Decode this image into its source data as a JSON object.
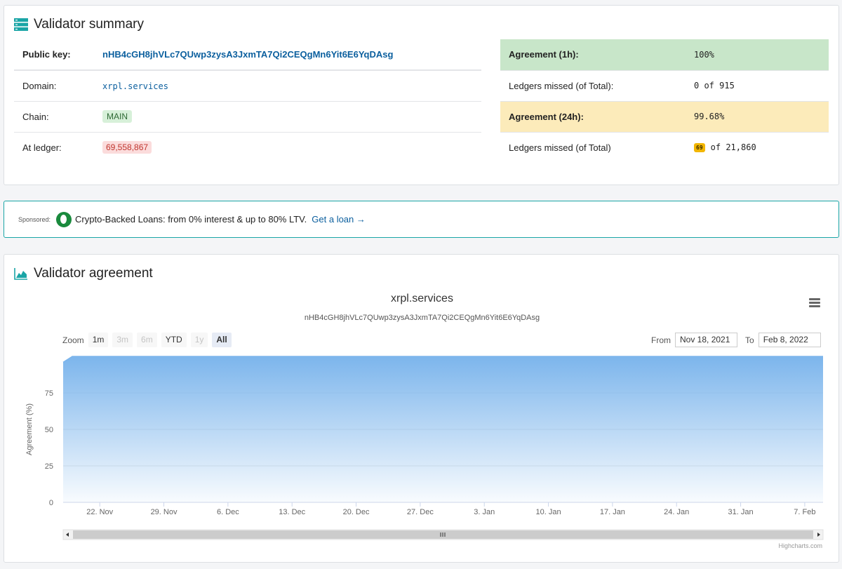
{
  "summary": {
    "title": "Validator summary",
    "left_rows": [
      {
        "key": "Public key:",
        "value": "nHB4cGH8jhVLc7QUwp3zysA3JxmTA7Qi2CEQgMn6Yit6E6YqDAsg"
      },
      {
        "key": "Domain:",
        "value": "xrpl.services"
      },
      {
        "key": "Chain:",
        "value": "MAIN"
      },
      {
        "key": "At ledger:",
        "value": "69,558,867"
      }
    ],
    "right_rows": [
      {
        "key": "Agreement (1h):",
        "value": "100%"
      },
      {
        "key": "Ledgers missed (of Total):",
        "value": "0 of 915"
      },
      {
        "key": "Agreement (24h):",
        "value": "99.68%"
      },
      {
        "key": "Ledgers missed (of Total)",
        "badge": "69",
        "value": "of 21,860"
      }
    ],
    "colors": {
      "agreement_1h_bg": "#c8e6c9",
      "agreement_24h_bg": "#fcebba"
    }
  },
  "sponsor": {
    "label": "Sponsored:",
    "text": "Crypto-Backed Loans: from 0% interest & up to 80% LTV.",
    "link": "Get a loan →"
  },
  "agreement_card": {
    "title": "Validator agreement",
    "zoom_label": "Zoom",
    "zoom_buttons": [
      {
        "label": "1m",
        "state": "enabled"
      },
      {
        "label": "3m",
        "state": "disabled"
      },
      {
        "label": "6m",
        "state": "disabled"
      },
      {
        "label": "YTD",
        "state": "enabled"
      },
      {
        "label": "1y",
        "state": "disabled"
      },
      {
        "label": "All",
        "state": "active"
      }
    ],
    "from_label": "From",
    "from_value": "Nov 18, 2021",
    "to_label": "To",
    "to_value": "Feb 8, 2022",
    "credits": "Highcharts.com",
    "menu_icon": "hamburger-menu-icon"
  },
  "chart_data": {
    "type": "area",
    "title": "xrpl.services",
    "subtitle": "nHB4cGH8jhVLc7QUwp3zysA3JxmTA7Qi2CEQgMn6Yit6E6YqDAsg",
    "ylabel": "Agreement (%)",
    "y_ticks": [
      0,
      25,
      50,
      75
    ],
    "ylim": [
      0,
      100
    ],
    "x_ticks": [
      "22. Nov",
      "29. Nov",
      "6. Dec",
      "13. Dec",
      "20. Dec",
      "27. Dec",
      "3. Jan",
      "10. Jan",
      "17. Jan",
      "24. Jan",
      "31. Jan",
      "7. Feb"
    ],
    "x_tick_days": [
      4,
      11,
      18,
      25,
      32,
      39,
      46,
      53,
      60,
      67,
      74,
      81
    ],
    "x_range_days": [
      0,
      83
    ],
    "x": [
      0,
      1,
      83
    ],
    "y": [
      96,
      100,
      100
    ],
    "color": "#7cb5ec"
  }
}
